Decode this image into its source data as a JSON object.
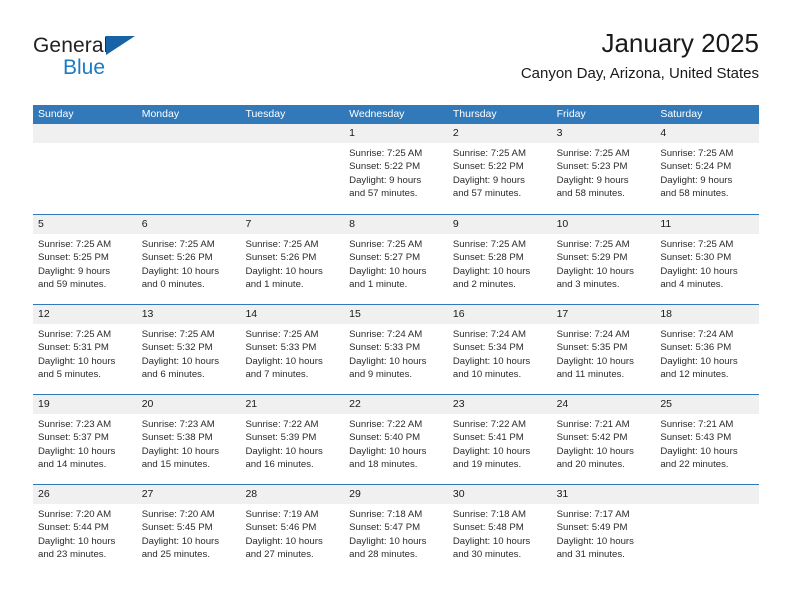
{
  "brand": {
    "line1": "General",
    "line2": "Blue",
    "flag_color": "#1763a5",
    "blue_color": "#1b7bc4"
  },
  "header": {
    "title": "January 2025",
    "subtitle": "Canyon Day, Arizona, United States"
  },
  "theme": {
    "header_band": "#3279ba",
    "daynum_band": "#f0f0f0",
    "row_rule": "#3279ba"
  },
  "weekdays": [
    "Sunday",
    "Monday",
    "Tuesday",
    "Wednesday",
    "Thursday",
    "Friday",
    "Saturday"
  ],
  "weeks": [
    [
      {
        "day": "",
        "lines": []
      },
      {
        "day": "",
        "lines": []
      },
      {
        "day": "",
        "lines": []
      },
      {
        "day": "1",
        "lines": [
          "Sunrise: 7:25 AM",
          "Sunset: 5:22 PM",
          "Daylight: 9 hours",
          "and 57 minutes."
        ]
      },
      {
        "day": "2",
        "lines": [
          "Sunrise: 7:25 AM",
          "Sunset: 5:22 PM",
          "Daylight: 9 hours",
          "and 57 minutes."
        ]
      },
      {
        "day": "3",
        "lines": [
          "Sunrise: 7:25 AM",
          "Sunset: 5:23 PM",
          "Daylight: 9 hours",
          "and 58 minutes."
        ]
      },
      {
        "day": "4",
        "lines": [
          "Sunrise: 7:25 AM",
          "Sunset: 5:24 PM",
          "Daylight: 9 hours",
          "and 58 minutes."
        ]
      }
    ],
    [
      {
        "day": "5",
        "lines": [
          "Sunrise: 7:25 AM",
          "Sunset: 5:25 PM",
          "Daylight: 9 hours",
          "and 59 minutes."
        ]
      },
      {
        "day": "6",
        "lines": [
          "Sunrise: 7:25 AM",
          "Sunset: 5:26 PM",
          "Daylight: 10 hours",
          "and 0 minutes."
        ]
      },
      {
        "day": "7",
        "lines": [
          "Sunrise: 7:25 AM",
          "Sunset: 5:26 PM",
          "Daylight: 10 hours",
          "and 1 minute."
        ]
      },
      {
        "day": "8",
        "lines": [
          "Sunrise: 7:25 AM",
          "Sunset: 5:27 PM",
          "Daylight: 10 hours",
          "and 1 minute."
        ]
      },
      {
        "day": "9",
        "lines": [
          "Sunrise: 7:25 AM",
          "Sunset: 5:28 PM",
          "Daylight: 10 hours",
          "and 2 minutes."
        ]
      },
      {
        "day": "10",
        "lines": [
          "Sunrise: 7:25 AM",
          "Sunset: 5:29 PM",
          "Daylight: 10 hours",
          "and 3 minutes."
        ]
      },
      {
        "day": "11",
        "lines": [
          "Sunrise: 7:25 AM",
          "Sunset: 5:30 PM",
          "Daylight: 10 hours",
          "and 4 minutes."
        ]
      }
    ],
    [
      {
        "day": "12",
        "lines": [
          "Sunrise: 7:25 AM",
          "Sunset: 5:31 PM",
          "Daylight: 10 hours",
          "and 5 minutes."
        ]
      },
      {
        "day": "13",
        "lines": [
          "Sunrise: 7:25 AM",
          "Sunset: 5:32 PM",
          "Daylight: 10 hours",
          "and 6 minutes."
        ]
      },
      {
        "day": "14",
        "lines": [
          "Sunrise: 7:25 AM",
          "Sunset: 5:33 PM",
          "Daylight: 10 hours",
          "and 7 minutes."
        ]
      },
      {
        "day": "15",
        "lines": [
          "Sunrise: 7:24 AM",
          "Sunset: 5:33 PM",
          "Daylight: 10 hours",
          "and 9 minutes."
        ]
      },
      {
        "day": "16",
        "lines": [
          "Sunrise: 7:24 AM",
          "Sunset: 5:34 PM",
          "Daylight: 10 hours",
          "and 10 minutes."
        ]
      },
      {
        "day": "17",
        "lines": [
          "Sunrise: 7:24 AM",
          "Sunset: 5:35 PM",
          "Daylight: 10 hours",
          "and 11 minutes."
        ]
      },
      {
        "day": "18",
        "lines": [
          "Sunrise: 7:24 AM",
          "Sunset: 5:36 PM",
          "Daylight: 10 hours",
          "and 12 minutes."
        ]
      }
    ],
    [
      {
        "day": "19",
        "lines": [
          "Sunrise: 7:23 AM",
          "Sunset: 5:37 PM",
          "Daylight: 10 hours",
          "and 14 minutes."
        ]
      },
      {
        "day": "20",
        "lines": [
          "Sunrise: 7:23 AM",
          "Sunset: 5:38 PM",
          "Daylight: 10 hours",
          "and 15 minutes."
        ]
      },
      {
        "day": "21",
        "lines": [
          "Sunrise: 7:22 AM",
          "Sunset: 5:39 PM",
          "Daylight: 10 hours",
          "and 16 minutes."
        ]
      },
      {
        "day": "22",
        "lines": [
          "Sunrise: 7:22 AM",
          "Sunset: 5:40 PM",
          "Daylight: 10 hours",
          "and 18 minutes."
        ]
      },
      {
        "day": "23",
        "lines": [
          "Sunrise: 7:22 AM",
          "Sunset: 5:41 PM",
          "Daylight: 10 hours",
          "and 19 minutes."
        ]
      },
      {
        "day": "24",
        "lines": [
          "Sunrise: 7:21 AM",
          "Sunset: 5:42 PM",
          "Daylight: 10 hours",
          "and 20 minutes."
        ]
      },
      {
        "day": "25",
        "lines": [
          "Sunrise: 7:21 AM",
          "Sunset: 5:43 PM",
          "Daylight: 10 hours",
          "and 22 minutes."
        ]
      }
    ],
    [
      {
        "day": "26",
        "lines": [
          "Sunrise: 7:20 AM",
          "Sunset: 5:44 PM",
          "Daylight: 10 hours",
          "and 23 minutes."
        ]
      },
      {
        "day": "27",
        "lines": [
          "Sunrise: 7:20 AM",
          "Sunset: 5:45 PM",
          "Daylight: 10 hours",
          "and 25 minutes."
        ]
      },
      {
        "day": "28",
        "lines": [
          "Sunrise: 7:19 AM",
          "Sunset: 5:46 PM",
          "Daylight: 10 hours",
          "and 27 minutes."
        ]
      },
      {
        "day": "29",
        "lines": [
          "Sunrise: 7:18 AM",
          "Sunset: 5:47 PM",
          "Daylight: 10 hours",
          "and 28 minutes."
        ]
      },
      {
        "day": "30",
        "lines": [
          "Sunrise: 7:18 AM",
          "Sunset: 5:48 PM",
          "Daylight: 10 hours",
          "and 30 minutes."
        ]
      },
      {
        "day": "31",
        "lines": [
          "Sunrise: 7:17 AM",
          "Sunset: 5:49 PM",
          "Daylight: 10 hours",
          "and 31 minutes."
        ]
      },
      {
        "day": "",
        "lines": []
      }
    ]
  ]
}
